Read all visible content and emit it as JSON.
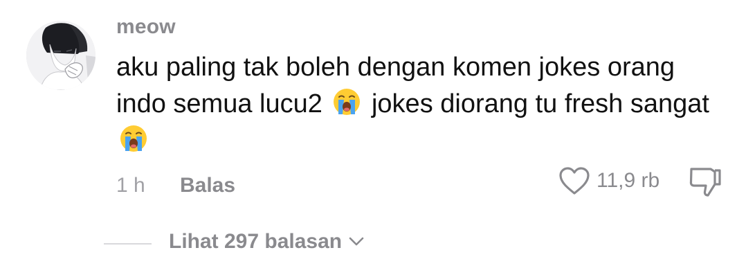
{
  "comment": {
    "username": "meow",
    "text_segments": [
      "aku paling tak boleh dengan komen jokes orang indo semua lucu2 ",
      " jokes diorang tu fresh sangat "
    ],
    "emoji": "loudly-crying-face-emoji",
    "time": "1 h",
    "reply_label": "Balas",
    "like_count": "11,9 rb",
    "view_replies_label": "Lihat 297 balasan"
  },
  "icons": {
    "like": "heart-outline-icon",
    "dislike": "thumbs-down-outline-icon",
    "expand": "chevron-down-icon"
  },
  "colors": {
    "username": "#8a8a8e",
    "text": "#111111",
    "muted": "#a1a1a6",
    "emoji_face": "#ffcc33",
    "emoji_tears": "#4aa3f0"
  }
}
